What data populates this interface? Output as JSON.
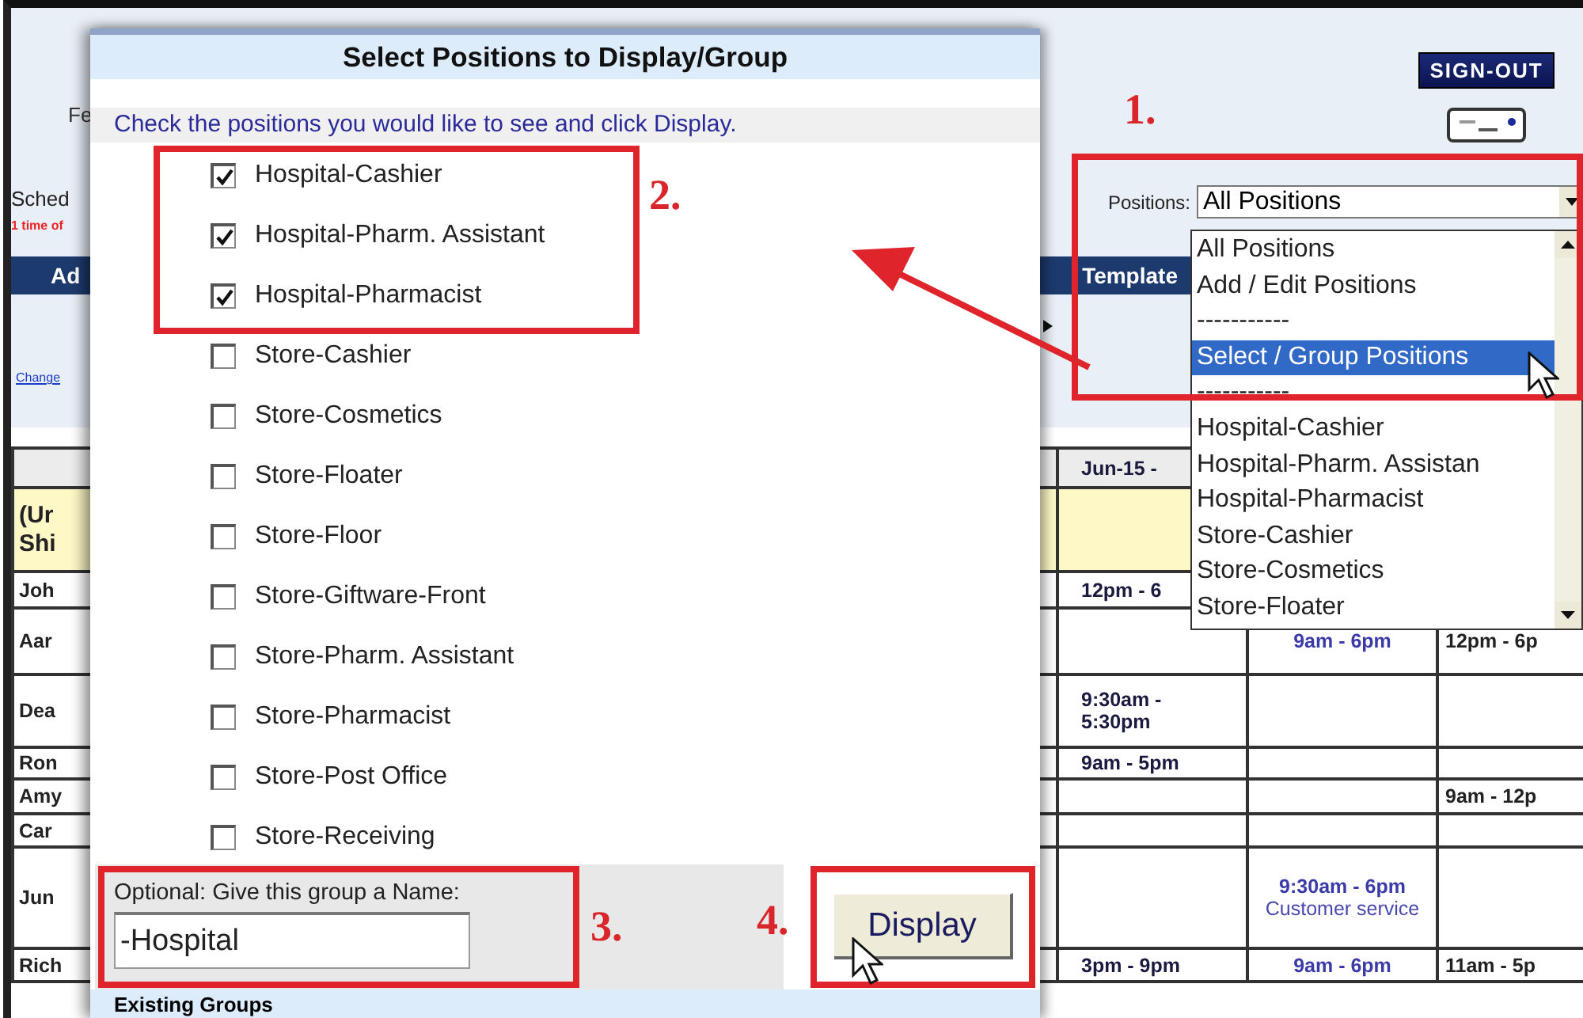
{
  "page": {
    "heading": "Fe",
    "sign_out": "SIGN-OUT",
    "schedule_label": "Sched",
    "notice": "1 time of",
    "positions_label": "Positions:",
    "positions_value": "All Positions",
    "nav_items": [
      "Ad",
      "Template"
    ],
    "change_link": "Change"
  },
  "schedule": {
    "date_header": "Jun-15 -",
    "group_label": [
      "(Ur",
      "Shi"
    ],
    "rows": [
      {
        "name": "Joh",
        "cells": [
          {
            "time": "12pm - 6"
          },
          null,
          null
        ]
      },
      {
        "name": "Aar",
        "cells": [
          null,
          {
            "time": "9am - 6pm"
          },
          {
            "time": "12pm - 6p"
          }
        ]
      },
      {
        "name": "Dea",
        "cells": [
          {
            "time": "9:30am - 5:30pm"
          },
          null,
          null
        ]
      },
      {
        "name": "Ron",
        "cells": [
          {
            "time": "9am - 5pm"
          },
          null,
          null
        ]
      },
      {
        "name": "Amy",
        "cells": [
          null,
          null,
          {
            "time": "9am - 12p"
          }
        ]
      },
      {
        "name": "Car",
        "cells": [
          null,
          null,
          null
        ]
      },
      {
        "name": "Jun",
        "cells": [
          null,
          {
            "time": "9:30am - 6pm",
            "note": "Customer service"
          },
          null
        ]
      },
      {
        "name": "Rich",
        "cells": [
          {
            "time": "3pm - 9pm"
          },
          {
            "time": "9am - 6pm"
          },
          {
            "time": "11am - 5p"
          }
        ]
      }
    ]
  },
  "position_dropdown": {
    "items": [
      {
        "label": "All Positions",
        "selected": false
      },
      {
        "label": "Add / Edit Positions",
        "selected": false
      },
      {
        "label": "-----------",
        "selected": false
      },
      {
        "label": "Select / Group Positions",
        "selected": true
      },
      {
        "label": "-----------",
        "selected": false
      },
      {
        "label": "Hospital-Cashier",
        "selected": false
      },
      {
        "label": "Hospital-Pharm. Assistan",
        "selected": false
      },
      {
        "label": "Hospital-Pharmacist",
        "selected": false
      },
      {
        "label": "Store-Cashier",
        "selected": false
      },
      {
        "label": "Store-Cosmetics",
        "selected": false
      },
      {
        "label": "Store-Floater",
        "selected": false
      }
    ]
  },
  "dialog": {
    "title": "Select Positions to Display/Group",
    "instruction": "Check the positions you would like to see and click Display.",
    "positions": [
      {
        "label": "Hospital-Cashier",
        "checked": true
      },
      {
        "label": "Hospital-Pharm. Assistant",
        "checked": true
      },
      {
        "label": "Hospital-Pharmacist",
        "checked": true
      },
      {
        "label": "Store-Cashier",
        "checked": false
      },
      {
        "label": "Store-Cosmetics",
        "checked": false
      },
      {
        "label": "Store-Floater",
        "checked": false
      },
      {
        "label": "Store-Floor",
        "checked": false
      },
      {
        "label": "Store-Giftware-Front",
        "checked": false
      },
      {
        "label": "Store-Pharm. Assistant",
        "checked": false
      },
      {
        "label": "Store-Pharmacist",
        "checked": false
      },
      {
        "label": "Store-Post Office",
        "checked": false
      },
      {
        "label": "Store-Receiving",
        "checked": false
      }
    ],
    "name_label": "Optional: Give this group a Name:",
    "name_value": "-Hospital",
    "display_button": "Display",
    "existing_groups": "Existing Groups"
  },
  "annotations": [
    {
      "label": "1."
    },
    {
      "label": "2."
    },
    {
      "label": "3."
    },
    {
      "label": "4."
    }
  ]
}
